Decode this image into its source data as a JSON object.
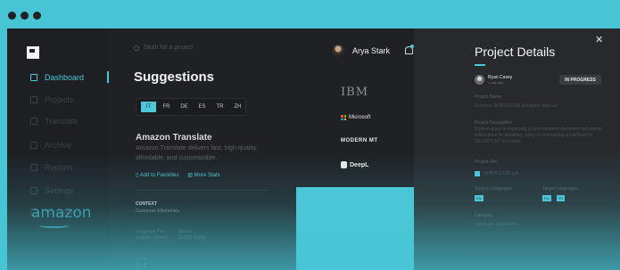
{
  "window": {
    "controls": [
      "close",
      "minimize",
      "maximize"
    ]
  },
  "sidebar": {
    "logo": "logo-square",
    "items": [
      {
        "label": "Dashboard",
        "icon": "home-icon",
        "active": true
      },
      {
        "label": "Projects",
        "icon": "folder-icon",
        "active": false
      },
      {
        "label": "Translate",
        "icon": "translate-icon",
        "active": false
      },
      {
        "label": "Archive",
        "icon": "archive-icon",
        "active": false
      },
      {
        "label": "Reports",
        "icon": "chart-icon",
        "active": false
      },
      {
        "label": "Settings",
        "icon": "settings-icon",
        "active": false
      },
      {
        "label": "Messages",
        "icon": "message-icon",
        "active": false
      }
    ]
  },
  "search": {
    "placeholder": "Seah for a project"
  },
  "main": {
    "title": "Suggestions",
    "languages": [
      "IT",
      "FR",
      "DE",
      "ES",
      "TR",
      "ZH"
    ],
    "active_language": "IT",
    "card": {
      "title": "Amazon Translate",
      "description": "Amazon Translate delivers fast, high-quality, affordable, and customizable.",
      "actions": [
        "Add to Favorites",
        "More Stats"
      ],
      "context_label": "CONTEXT",
      "context_value": "Consumer Electronics",
      "language_pair_label": "Language Pair",
      "language_pair_value": "English - French",
      "words_label": "Words",
      "words_value": "12,000 Words",
      "score_label": "Score",
      "score_value": "9.4"
    }
  },
  "user": {
    "name": "Arya Stark"
  },
  "providers": [
    "IBM",
    "Microsoft",
    "MODERN MT",
    "DeepL",
    "amazon"
  ],
  "details": {
    "title": "Project Details",
    "owner_name": "Ryan Casey",
    "owner_time": "1 day ago",
    "status": "IN PROGRESS",
    "project_name_label": "Project Name",
    "project_name_value": "Siemens SPROGUODI Navigator Manual",
    "project_description_label": "Project Description",
    "project_description_value": "Sodium-glass is especially a fresh-tempest document simulating instructions on installing, using or maintaining a hardware in SIGLMPORT on canon",
    "project_file_label": "Project File",
    "project_file_value": "SPROGUODI.pdf",
    "source_language_label": "Source Languages",
    "source_language_value": "EN",
    "target_languages_label": "Target Languages",
    "target_languages": [
      "EN",
      "FR"
    ],
    "category_label": "Category",
    "category_value": "Consumer Electronics"
  },
  "colors": {
    "accent": "#4cc6d8",
    "background": "#1f2124",
    "panel": "#27292c"
  }
}
